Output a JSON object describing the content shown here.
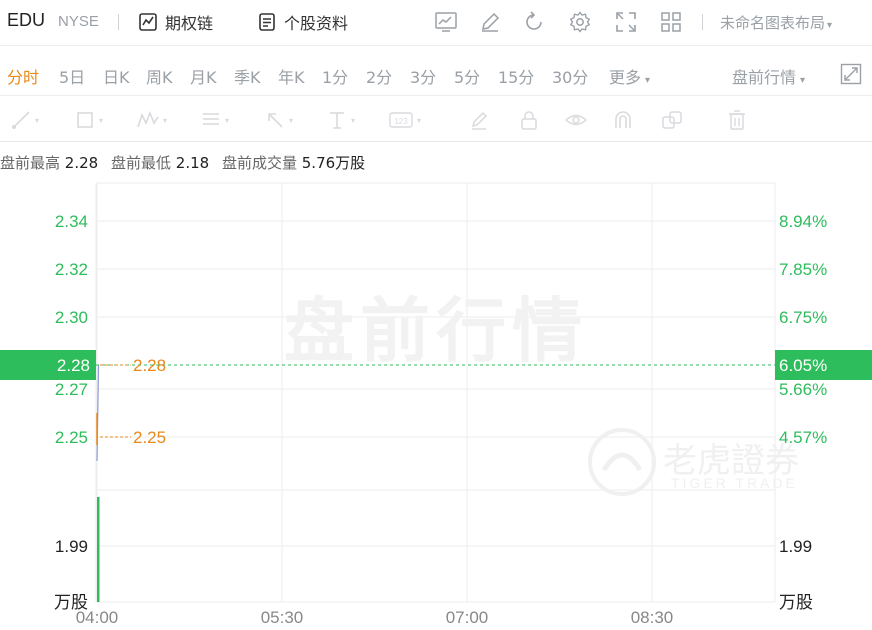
{
  "header": {
    "ticker": "EDU",
    "exchange": "NYSE",
    "links": [
      {
        "label": "期权链",
        "icon": "option-chain-icon"
      },
      {
        "label": "个股资料",
        "icon": "document-icon"
      }
    ],
    "tool_icons": [
      "trend-chart-icon",
      "edit-icon",
      "refresh-icon",
      "settings-icon",
      "fullscreen-icon",
      "grid-layout-icon"
    ],
    "layout_name": "未命名图表布局",
    "layout_caret": "▾"
  },
  "periods": {
    "tabs": [
      "分时",
      "5日",
      "日K",
      "周K",
      "月K",
      "季K",
      "年K",
      "1分",
      "2分",
      "3分",
      "5分",
      "15分",
      "30分"
    ],
    "active": "分时",
    "more_label": "更多",
    "session_label": "盘前行情",
    "caret": "▾"
  },
  "drawing_tools": [
    "line-tool-icon",
    "rectangle-tool-icon",
    "pattern-tool-icon",
    "fibonacci-tool-icon",
    "arrow-tool-icon",
    "text-tool-icon",
    "measure-tool-icon",
    "brush-icon",
    "lock-icon",
    "visibility-icon",
    "magnet-icon",
    "layers-icon",
    "trash-icon"
  ],
  "stats": {
    "high_label": "盘前最高",
    "high_value": "2.28",
    "low_label": "盘前最低",
    "low_value": "2.18",
    "volume_label": "盘前成交量",
    "volume_value": "5.76万股"
  },
  "watermark": {
    "text": "盘前行情",
    "brand": "老虎證券",
    "brand_en": "TIGER TRADE"
  },
  "colors": {
    "up": "#2ebd5c",
    "accent": "#e8891c",
    "current_price_bg": "#2ebd5c",
    "grid": "#eeeeee"
  },
  "chart_data": {
    "type": "line",
    "price_axis": {
      "ticks": [
        "2.34",
        "2.32",
        "2.30",
        "2.27",
        "2.25"
      ],
      "tick_values": [
        2.34,
        2.32,
        2.3,
        2.27,
        2.25
      ],
      "percent_ticks": [
        "8.94%",
        "7.85%",
        "6.75%",
        "5.66%",
        "4.57%"
      ]
    },
    "current_price": {
      "value": 2.28,
      "label": "2.28",
      "percent": "6.05%"
    },
    "price_markers": [
      {
        "value": 2.28,
        "label": "2.28"
      },
      {
        "value": 2.25,
        "label": "2.25"
      }
    ],
    "price_series": [
      {
        "time": "04:00",
        "price": 2.24
      },
      {
        "time": "04:00",
        "price": 2.28
      }
    ],
    "volume_axis": {
      "left_tick": "1.99",
      "right_tick": "1.99",
      "unit_left": "万股",
      "unit_right": "万股"
    },
    "volume_bars": [
      {
        "time": "04:00",
        "value": 5.76
      }
    ],
    "x_ticks": [
      "04:00",
      "05:30",
      "07:00",
      "08:30"
    ]
  }
}
